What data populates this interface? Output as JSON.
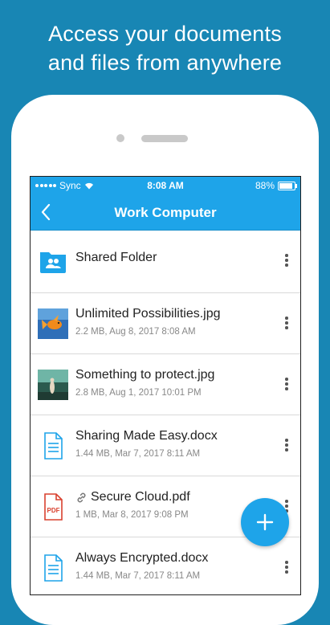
{
  "promo": {
    "line1": "Access your documents",
    "line2": "and files from anywhere"
  },
  "status_bar": {
    "carrier": "Sync",
    "time": "8:08 AM",
    "battery": "88%"
  },
  "nav": {
    "title": "Work Computer",
    "back_icon": "chevron-left-icon"
  },
  "files": [
    {
      "name": "Shared Folder",
      "meta": "",
      "type": "shared-folder"
    },
    {
      "name": "Unlimited Possibilities.jpg",
      "meta": "2.2 MB, Aug 8, 2017 8:08 AM",
      "type": "image"
    },
    {
      "name": "Something to protect.jpg",
      "meta": "2.8 MB, Aug 1, 2017 10:01 PM",
      "type": "image"
    },
    {
      "name": "Sharing Made Easy.docx",
      "meta": "1.44 MB, Mar 7, 2017 8:11 AM",
      "type": "doc"
    },
    {
      "name": "Secure Cloud.pdf",
      "meta": "1 MB, Mar 8, 2017 9:08 PM",
      "type": "pdf",
      "pdf_label": "PDF",
      "shared_link": true
    },
    {
      "name": "Always Encrypted.docx",
      "meta": "1.44 MB, Mar 7, 2017 8:11 AM",
      "type": "doc"
    }
  ],
  "fab": {
    "icon": "plus-icon"
  },
  "colors": {
    "background": "#1886b4",
    "accent": "#1ea4e9",
    "pdf_red": "#d9412f"
  }
}
